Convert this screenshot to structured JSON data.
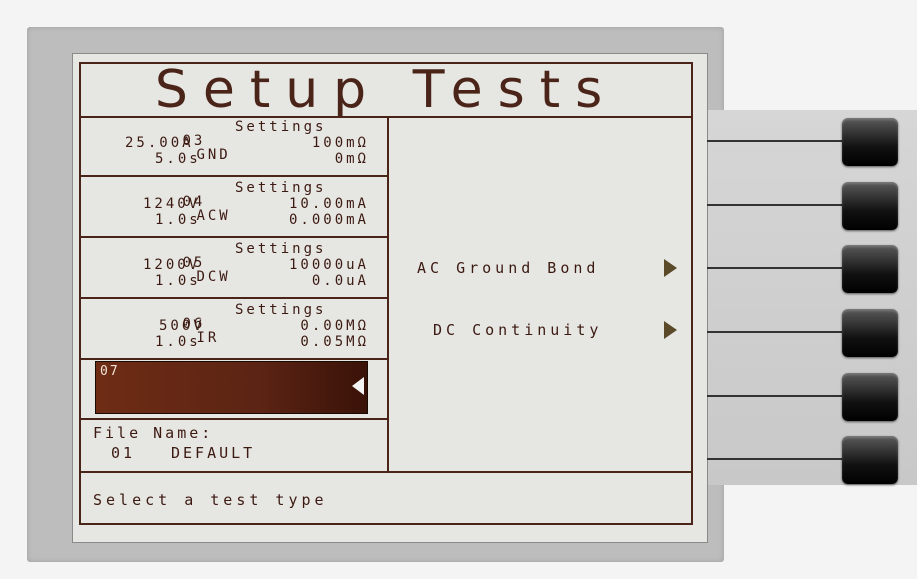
{
  "screen": {
    "title": "Setup Tests",
    "tests": [
      {
        "number": "03",
        "type": "GND",
        "settings_label": "Settings",
        "param1": "25.00A",
        "param2": "5.0s",
        "limit_high": "100mΩ",
        "limit_low": "0mΩ"
      },
      {
        "number": "04",
        "type": "ACW",
        "settings_label": "Settings",
        "param1": "1240V",
        "param2": "1.0s",
        "limit_high": "10.00mA",
        "limit_low": "0.000mA"
      },
      {
        "number": "05",
        "type": "DCW",
        "settings_label": "Settings",
        "param1": "1200V",
        "param2": "1.0s",
        "limit_high": "10000uA",
        "limit_low": "0.0uA"
      },
      {
        "number": "06",
        "type": "IR",
        "settings_label": "Settings",
        "param1": "500V",
        "param2": "1.0s",
        "limit_high": "0.00MΩ",
        "limit_low": "0.05MΩ"
      }
    ],
    "selected_test": {
      "number": "07"
    },
    "file": {
      "label": "File Name:",
      "number": "01",
      "name": "DEFAULT"
    },
    "menu": {
      "item1": "AC Ground Bond",
      "item2": "DC Continuity"
    },
    "status": "Select a test type"
  },
  "softkeys": [
    "softkey-1",
    "softkey-2",
    "softkey-3",
    "softkey-4",
    "softkey-5",
    "softkey-6"
  ],
  "colors": {
    "text": "#3c1a12",
    "selection": "#6e2c14",
    "screen": "#e6e6e2"
  }
}
